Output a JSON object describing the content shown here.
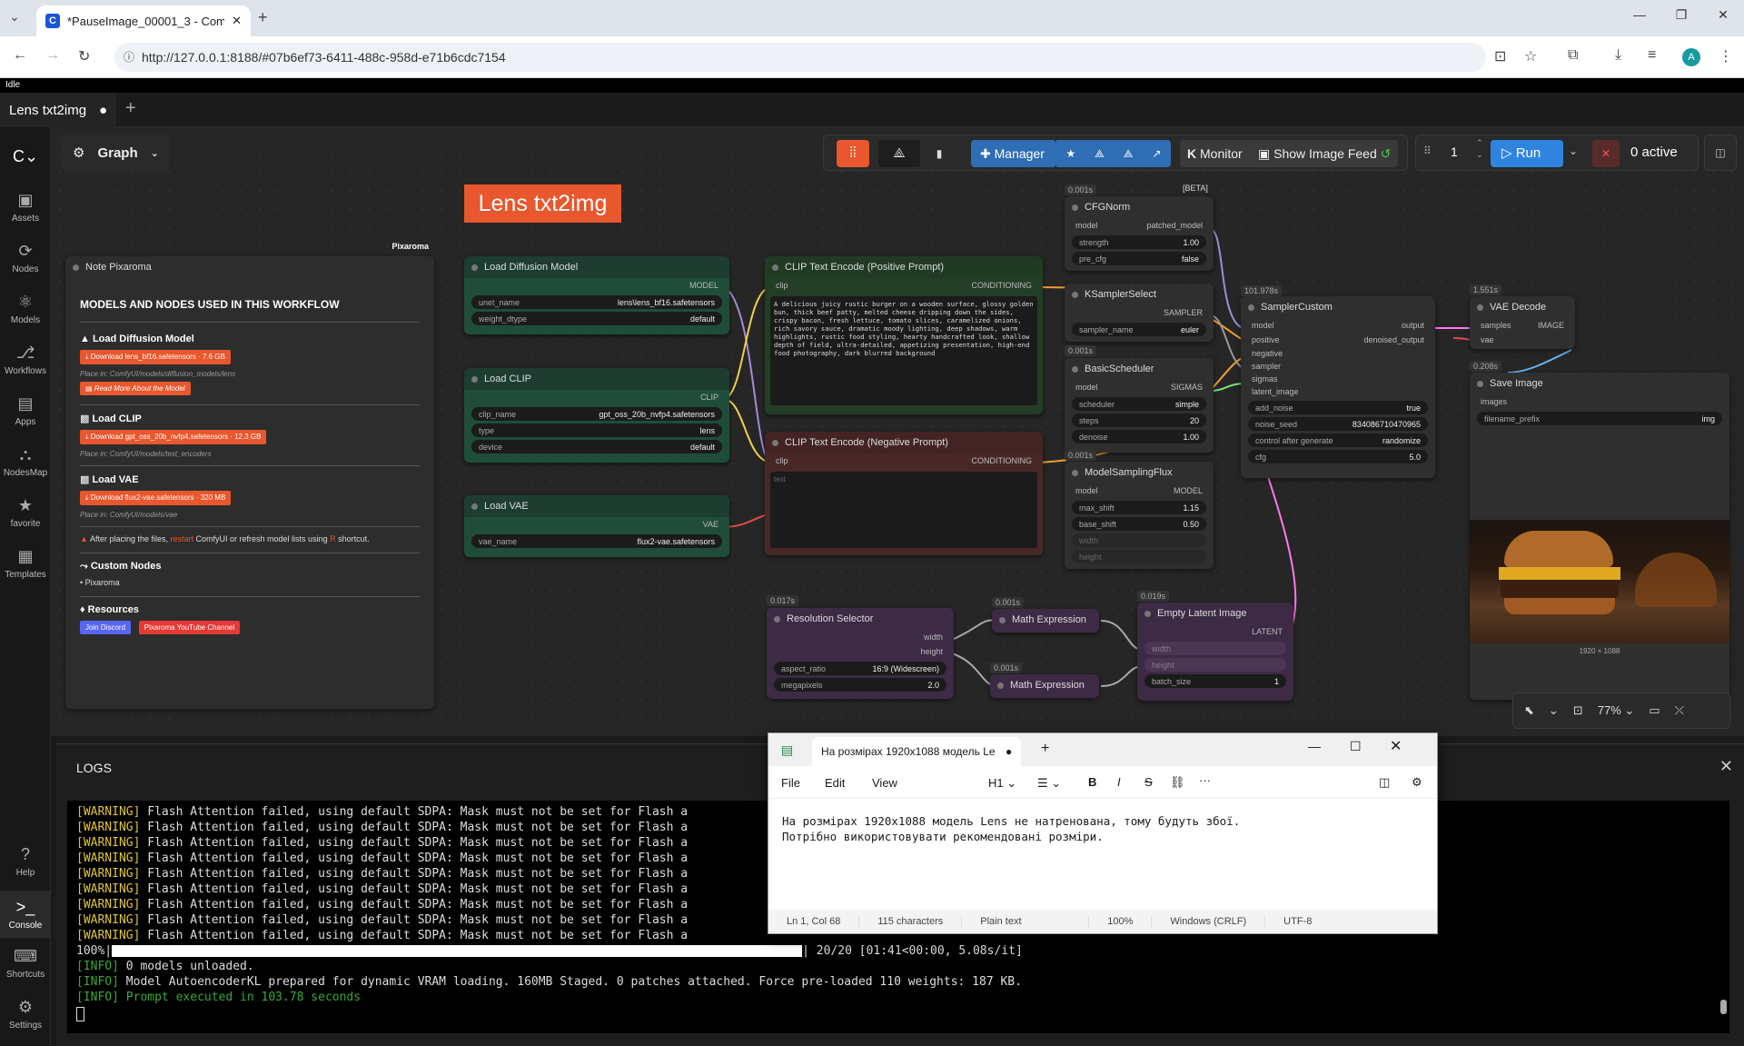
{
  "browser": {
    "tab_title": "*PauseImage_00001_3 - Comfy",
    "url": "http://127.0.0.1:8188/#07b6ef73-6411-488c-958d-e71b6cdc7154",
    "profile_initial": "A"
  },
  "status": {
    "idle": "Idle"
  },
  "workflow_tab": {
    "label": "Lens txt2img"
  },
  "graph_menu": {
    "label": "Graph"
  },
  "sidebar": {
    "items": [
      {
        "label": "Assets"
      },
      {
        "label": "Nodes"
      },
      {
        "label": "Models"
      },
      {
        "label": "Workflows"
      },
      {
        "label": "Apps"
      },
      {
        "label": "NodesMap"
      },
      {
        "label": "favorite"
      },
      {
        "label": "Templates"
      },
      {
        "label": "Help"
      },
      {
        "label": "Console"
      },
      {
        "label": "Shortcuts"
      },
      {
        "label": "Settings"
      }
    ]
  },
  "toolbar": {
    "manager": "Manager",
    "monitor": "Monitor",
    "show_image_feed": "Show Image Feed",
    "batch_count": "1",
    "run": "Run",
    "active": "0 active"
  },
  "canvas_title": "Lens txt2img",
  "note": {
    "brand": "Pixaroma",
    "title": "Note Pixaroma",
    "heading": "MODELS AND NODES USED IN THIS WORKFLOW",
    "sections": [
      {
        "title": "Load Diffusion Model",
        "download": "Download lens_bf16.safetensors · 7.6 GB",
        "place": "Place in: ComfyUI/models/diffusion_models/lens",
        "extra": "Read More About the Model"
      },
      {
        "title": "Load CLIP",
        "download": "Download gpt_oss_20b_nvfp4.safetensors · 12.3 GB",
        "place": "Place in: ComfyUI/models/text_encoders"
      },
      {
        "title": "Load VAE",
        "download": "Download flux2-vae.safetensors · 320 MB",
        "place": "Place in: ComfyUI/models/vae"
      }
    ],
    "warning_pre": "After placing the files,",
    "warning_restart": "restart",
    "warning_post": "ComfyUI or refresh model lists using",
    "warning_key": "R",
    "warning_end": "shortcut.",
    "custom_nodes_title": "Custom Nodes",
    "custom_nodes_item": "Pixaroma",
    "resources_title": "Resources",
    "discord": "Join Discord",
    "youtube": "Pixaroma YouTube Channel"
  },
  "nodes": {
    "load_diffusion": {
      "title": "Load Diffusion Model",
      "out": "MODEL",
      "unet_name_label": "unet_name",
      "unet_name": "lens\\lens_bf16.safetensors",
      "weight_dtype_label": "weight_dtype",
      "weight_dtype": "default"
    },
    "load_clip": {
      "title": "Load CLIP",
      "out": "CLIP",
      "clip_name_label": "clip_name",
      "clip_name": "gpt_oss_20b_nvfp4.safetensors",
      "type_label": "type",
      "type": "lens",
      "device_label": "device",
      "device": "default"
    },
    "load_vae": {
      "title": "Load VAE",
      "out": "VAE",
      "vae_name_label": "vae_name",
      "vae_name": "flux2-vae.safetensors"
    },
    "clip_pos": {
      "title": "CLIP Text Encode (Positive Prompt)",
      "in": "clip",
      "out": "CONDITIONING",
      "text": "A delicious juicy rustic burger on a wooden surface, glossy golden bun, thick beef patty, melted cheese dripping down the sides, crispy bacon, fresh lettuce, tomato slices, caramelized onions, rich savory sauce, dramatic moody lighting, deep shadows, warm highlights, rustic food styling, hearty handcrafted look, shallow depth of field, ultra-detailed, appetizing presentation, high-end food photography, dark blurred background"
    },
    "clip_neg": {
      "title": "CLIP Text Encode (Negative Prompt)",
      "in": "clip",
      "out": "CONDITIONING",
      "placeholder": "text"
    },
    "cfgnorm": {
      "title": "CFGNorm",
      "timing": "0.001s",
      "in": "model",
      "out": "patched_model",
      "strength_label": "strength",
      "strength": "1.00",
      "pre_cfg_label": "pre_cfg",
      "pre_cfg": "false",
      "beta": "[BETA]"
    },
    "ksampler_select": {
      "title": "KSamplerSelect",
      "out": "SAMPLER",
      "sampler_name_label": "sampler_name",
      "sampler_name": "euler"
    },
    "basic_scheduler": {
      "title": "BasicScheduler",
      "timing": "0.001s",
      "in": "model",
      "out": "SIGMAS",
      "scheduler_label": "scheduler",
      "scheduler": "simple",
      "steps_label": "steps",
      "steps": "20",
      "denoise_label": "denoise",
      "denoise": "1.00"
    },
    "model_sampling": {
      "title": "ModelSamplingFlux",
      "timing": "0.001s",
      "in": "model",
      "out": "MODEL",
      "max_shift_label": "max_shift",
      "max_shift": "1.15",
      "base_shift_label": "base_shift",
      "base_shift": "0.50",
      "width": "width",
      "height": "height"
    },
    "sampler_custom": {
      "title": "SamplerCustom",
      "timing": "101.978s",
      "inputs": [
        "model",
        "positive",
        "negative",
        "sampler",
        "sigmas",
        "latent_image"
      ],
      "out1": "output",
      "out2": "denoised_output",
      "add_noise_label": "add_noise",
      "add_noise": "true",
      "noise_seed_label": "noise_seed",
      "noise_seed": "834086710470965",
      "control_label": "control after generate",
      "control": "randomize",
      "cfg_label": "cfg",
      "cfg": "5.0"
    },
    "vae_decode": {
      "title": "VAE Decode",
      "timing": "1.551s",
      "in1": "samples",
      "in2": "vae",
      "out": "IMAGE"
    },
    "save_image": {
      "title": "Save Image",
      "timing": "0.208s",
      "in": "images",
      "prefix_label": "filename_prefix",
      "prefix": "img",
      "image_size": "1920 × 1088"
    },
    "resolution": {
      "title": "Resolution Selector",
      "timing": "0.017s",
      "out1": "width",
      "out2": "height",
      "aspect_label": "aspect_ratio",
      "aspect": "16:9 (Widescreen)",
      "mp_label": "megapixels",
      "mp": "2.0"
    },
    "math1": {
      "title": "Math Expression",
      "timing": "0.001s"
    },
    "math2": {
      "title": "Math Expression",
      "timing": "0.001s"
    },
    "empty_latent": {
      "title": "Empty Latent Image",
      "timing": "0.019s",
      "out": "LATENT",
      "width": "width",
      "height": "height",
      "batch_label": "batch_size",
      "batch": "1"
    }
  },
  "zoom": {
    "level": "77%"
  },
  "logs": {
    "title": "LOGS",
    "warning_tag": "[WARNING]",
    "warning_text": "Flash Attention failed, using default SDPA: Mask must not be set for Flash a",
    "warning_count": 9,
    "progress_pre": "100%|",
    "progress_post": "| 20/20 [01:41<00:00,  5.08s/it]",
    "info1_tag": "[INFO]",
    "info1": "0 models unloaded.",
    "info2_tag": "[INFO]",
    "info2": "Model AutoencoderKL prepared for dynamic VRAM loading. 160MB Staged. 0 patches attached. Force pre-loaded 110 weights: 187 KB.",
    "info3_tag": "[INFO]",
    "info3": "Prompt executed in 103.78 seconds"
  },
  "notepad": {
    "tab": "На розмірах 1920x1088 модель Le",
    "menu": [
      "File",
      "Edit",
      "View"
    ],
    "heading": "H1",
    "line1": "На розмірах 1920x1088 модель Lens не натренована, тому будуть збої.",
    "line2": "Потрібно використовувати рекомендовані розміри.",
    "status": [
      "Ln 1, Col 68",
      "115 characters",
      "Plain text",
      "100%",
      "Windows (CRLF)",
      "UTF-8"
    ]
  }
}
